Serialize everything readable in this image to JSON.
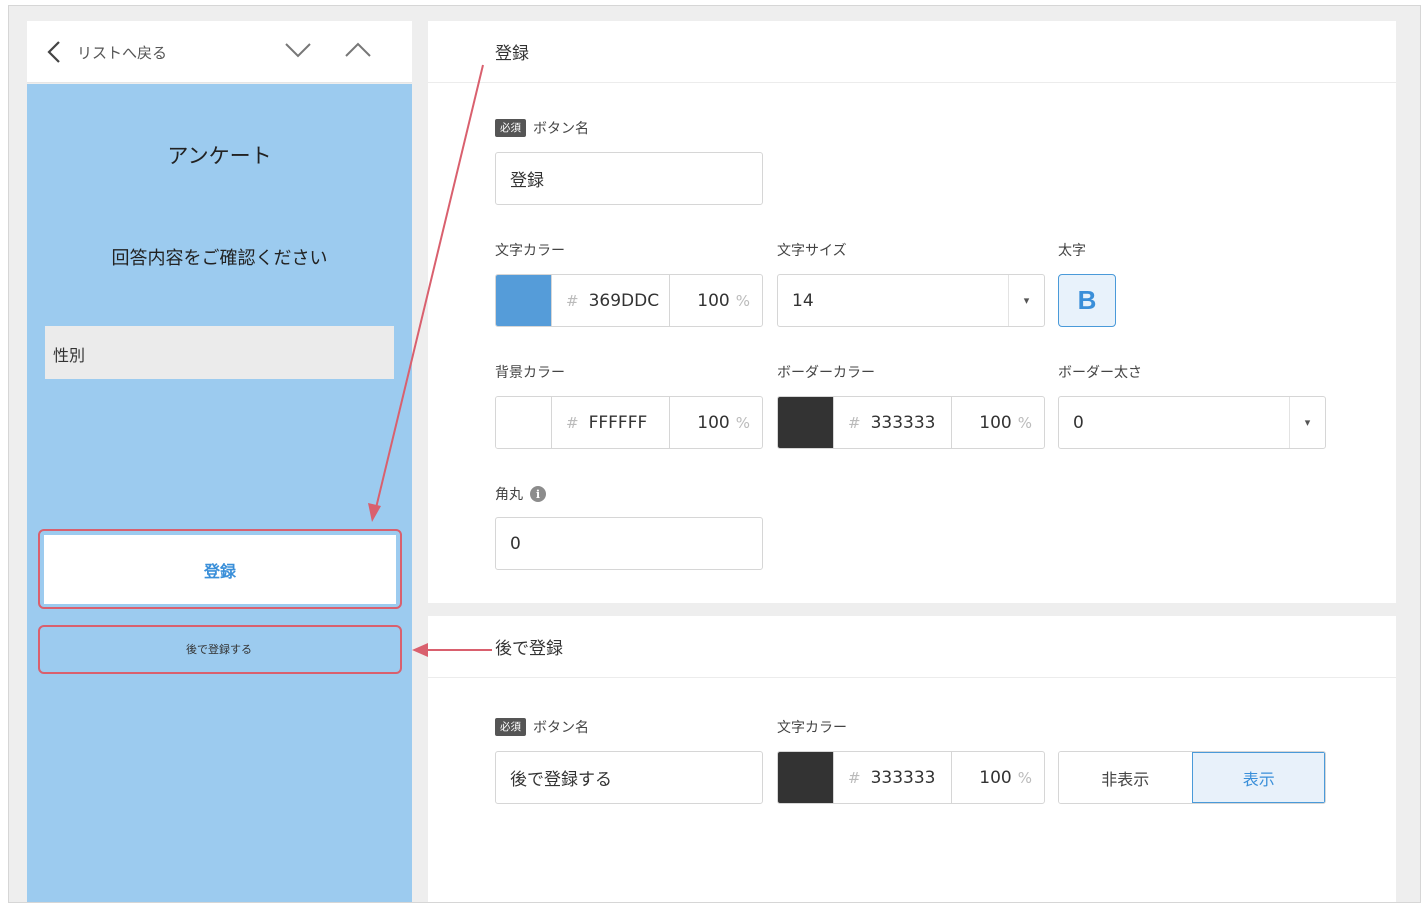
{
  "nav": {
    "back_label": "リストへ戻る"
  },
  "preview": {
    "title": "アンケート",
    "subtitle": "回答内容をご確認ください",
    "field_label": "性別",
    "register_button": "登録",
    "later_button": "後で登録する"
  },
  "register_panel": {
    "heading": "登録",
    "required_badge": "必須",
    "button_name_label": "ボタン名",
    "button_name_value": "登録",
    "text_color_label": "文字カラー",
    "text_color": {
      "swatch": "#369DDC",
      "hex": "369DDC",
      "alpha": "100",
      "pct": "%"
    },
    "text_size_label": "文字サイズ",
    "text_size_value": "14",
    "bold_label": "太字",
    "bold_glyph": "B",
    "bg_color_label": "背景カラー",
    "bg_color": {
      "swatch": "#FFFFFF",
      "hex": "FFFFFF",
      "alpha": "100",
      "pct": "%"
    },
    "border_color_label": "ボーダーカラー",
    "border_color": {
      "swatch": "#333333",
      "hex": "333333",
      "alpha": "100",
      "pct": "%"
    },
    "border_width_label": "ボーダー太さ",
    "border_width_value": "0",
    "radius_label": "角丸",
    "radius_value": "0"
  },
  "later_panel": {
    "heading": "後で登録",
    "required_badge": "必須",
    "button_name_label": "ボタン名",
    "button_name_value": "後で登録する",
    "text_color_label": "文字カラー",
    "text_color": {
      "swatch": "#333333",
      "hex": "333333",
      "alpha": "100",
      "pct": "%"
    },
    "visibility_options": [
      "非表示",
      "表示"
    ],
    "visibility_selected": "表示"
  },
  "hash_symbol": "#",
  "dropdown_caret": "▾",
  "info_glyph": "i",
  "colors": {
    "preview_bg": "#9CCBEF",
    "accent": "#3A8FD9",
    "annotation": "#D9606E"
  }
}
